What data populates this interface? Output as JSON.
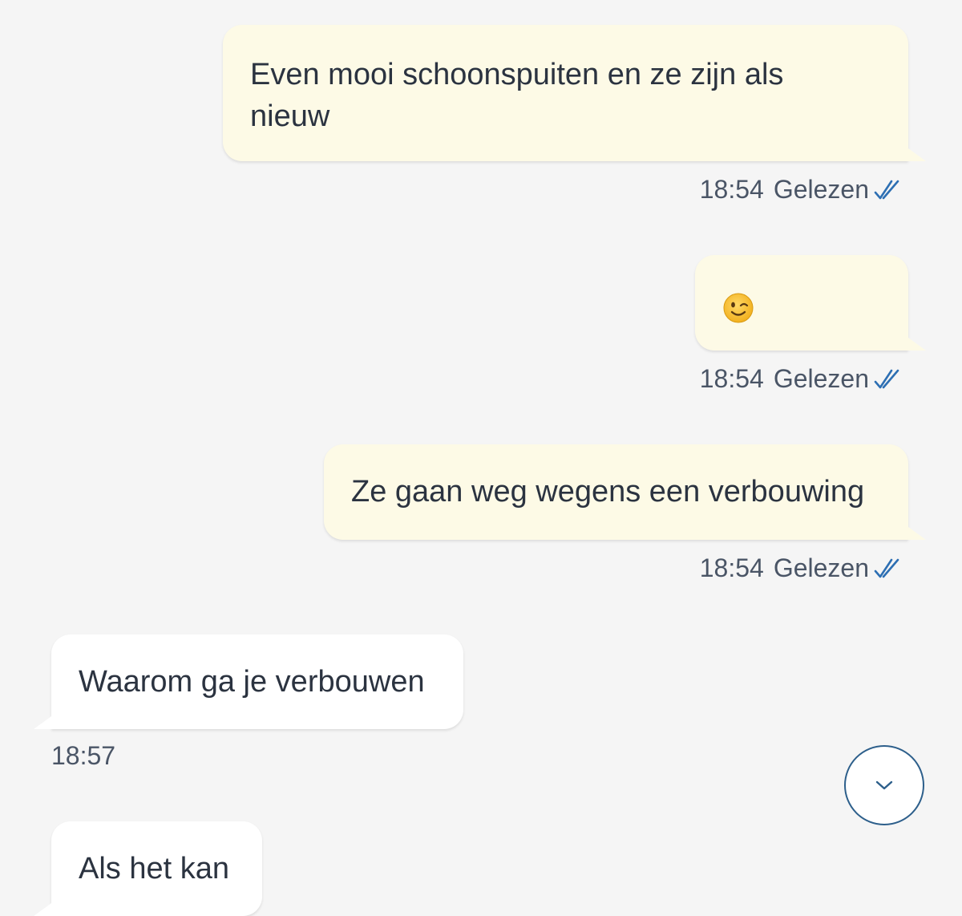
{
  "messages": [
    {
      "direction": "outgoing",
      "text": "Even mooi schoonspuiten en ze zijn als\nnieuw",
      "time": "18:54",
      "status": "Gelezen",
      "status_icon": "double-check-icon"
    },
    {
      "direction": "outgoing",
      "text": "",
      "emoji": "winking-face-emoji",
      "time": "18:54",
      "status": "Gelezen",
      "status_icon": "double-check-icon"
    },
    {
      "direction": "outgoing",
      "text": "Ze gaan weg wegens een verbouwing",
      "time": "18:54",
      "status": "Gelezen",
      "status_icon": "double-check-icon"
    },
    {
      "direction": "incoming",
      "text": "Waarom ga je verbouwen",
      "time": "18:57"
    },
    {
      "direction": "incoming",
      "text": "Als het kan"
    }
  ],
  "scroll_button": {
    "icon": "chevron-down-icon"
  },
  "colors": {
    "background": "#f5f5f5",
    "outgoing_bubble": "#fdfae6",
    "incoming_bubble": "#ffffff",
    "read_tick": "#2d6fb3",
    "scroll_button_border": "#2d5f8b"
  }
}
